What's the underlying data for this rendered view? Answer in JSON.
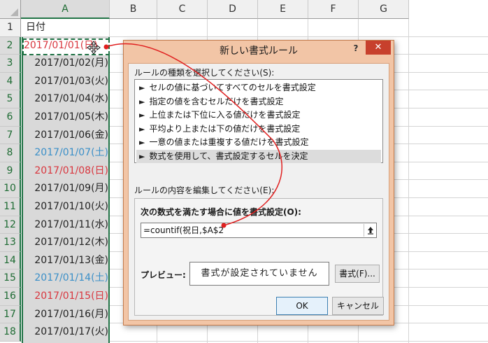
{
  "spreadsheet": {
    "columns": [
      "A",
      "B",
      "C",
      "D",
      "E",
      "F",
      "G"
    ],
    "rows": [
      "1",
      "2",
      "3",
      "4",
      "5",
      "6",
      "7",
      "8",
      "9",
      "10",
      "11",
      "12",
      "13",
      "14",
      "15",
      "16",
      "17",
      "18"
    ],
    "header_cell": "日付",
    "dates": [
      {
        "text": "2017/01/01(日)",
        "color": "#d9363e"
      },
      {
        "text": "2017/01/02(月)",
        "color": "#222222"
      },
      {
        "text": "2017/01/03(火)",
        "color": "#222222"
      },
      {
        "text": "2017/01/04(水)",
        "color": "#222222"
      },
      {
        "text": "2017/01/05(木)",
        "color": "#222222"
      },
      {
        "text": "2017/01/06(金)",
        "color": "#222222"
      },
      {
        "text": "2017/01/07(土)",
        "color": "#3a8fc8"
      },
      {
        "text": "2017/01/08(日)",
        "color": "#d9363e"
      },
      {
        "text": "2017/01/09(月)",
        "color": "#222222"
      },
      {
        "text": "2017/01/10(火)",
        "color": "#222222"
      },
      {
        "text": "2017/01/11(水)",
        "color": "#222222"
      },
      {
        "text": "2017/01/12(木)",
        "color": "#222222"
      },
      {
        "text": "2017/01/13(金)",
        "color": "#222222"
      },
      {
        "text": "2017/01/14(土)",
        "color": "#3a8fc8"
      },
      {
        "text": "2017/01/15(日)",
        "color": "#d9363e"
      },
      {
        "text": "2017/01/16(月)",
        "color": "#222222"
      },
      {
        "text": "2017/01/17(火)",
        "color": "#222222"
      }
    ],
    "accent_color": "#217346"
  },
  "dialog": {
    "title": "新しい書式ルール",
    "help_label": "?",
    "close_label": "✕",
    "rule_type_label": "ルールの種類を選択してください(S):",
    "rule_types": [
      {
        "label": "セルの値に基づいてすべてのセルを書式設定",
        "selected": false
      },
      {
        "label": "指定の値を含むセルだけを書式設定",
        "selected": false
      },
      {
        "label": "上位または下位に入る値だけを書式設定",
        "selected": false
      },
      {
        "label": "平均より上または下の値だけを書式設定",
        "selected": false
      },
      {
        "label": "一意の値または重複する値だけを書式設定",
        "selected": false
      },
      {
        "label": "数式を使用して、書式設定するセルを決定",
        "selected": true
      }
    ],
    "rule_edit_label": "ルールの内容を編集してください(E):",
    "formula_label": "次の数式を満たす場合に値を書式設定(O):",
    "formula_value": "=countif(祝日,$A$2",
    "preview_label": "プレビュー:",
    "preview_text": "書式が設定されていません",
    "format_button": "書式(F)...",
    "ok_button": "OK",
    "cancel_button": "キャンセル",
    "title_bg": "#f2c5a6",
    "close_bg": "#c7402c"
  },
  "annotation": {
    "arrow_color": "#e02020"
  }
}
